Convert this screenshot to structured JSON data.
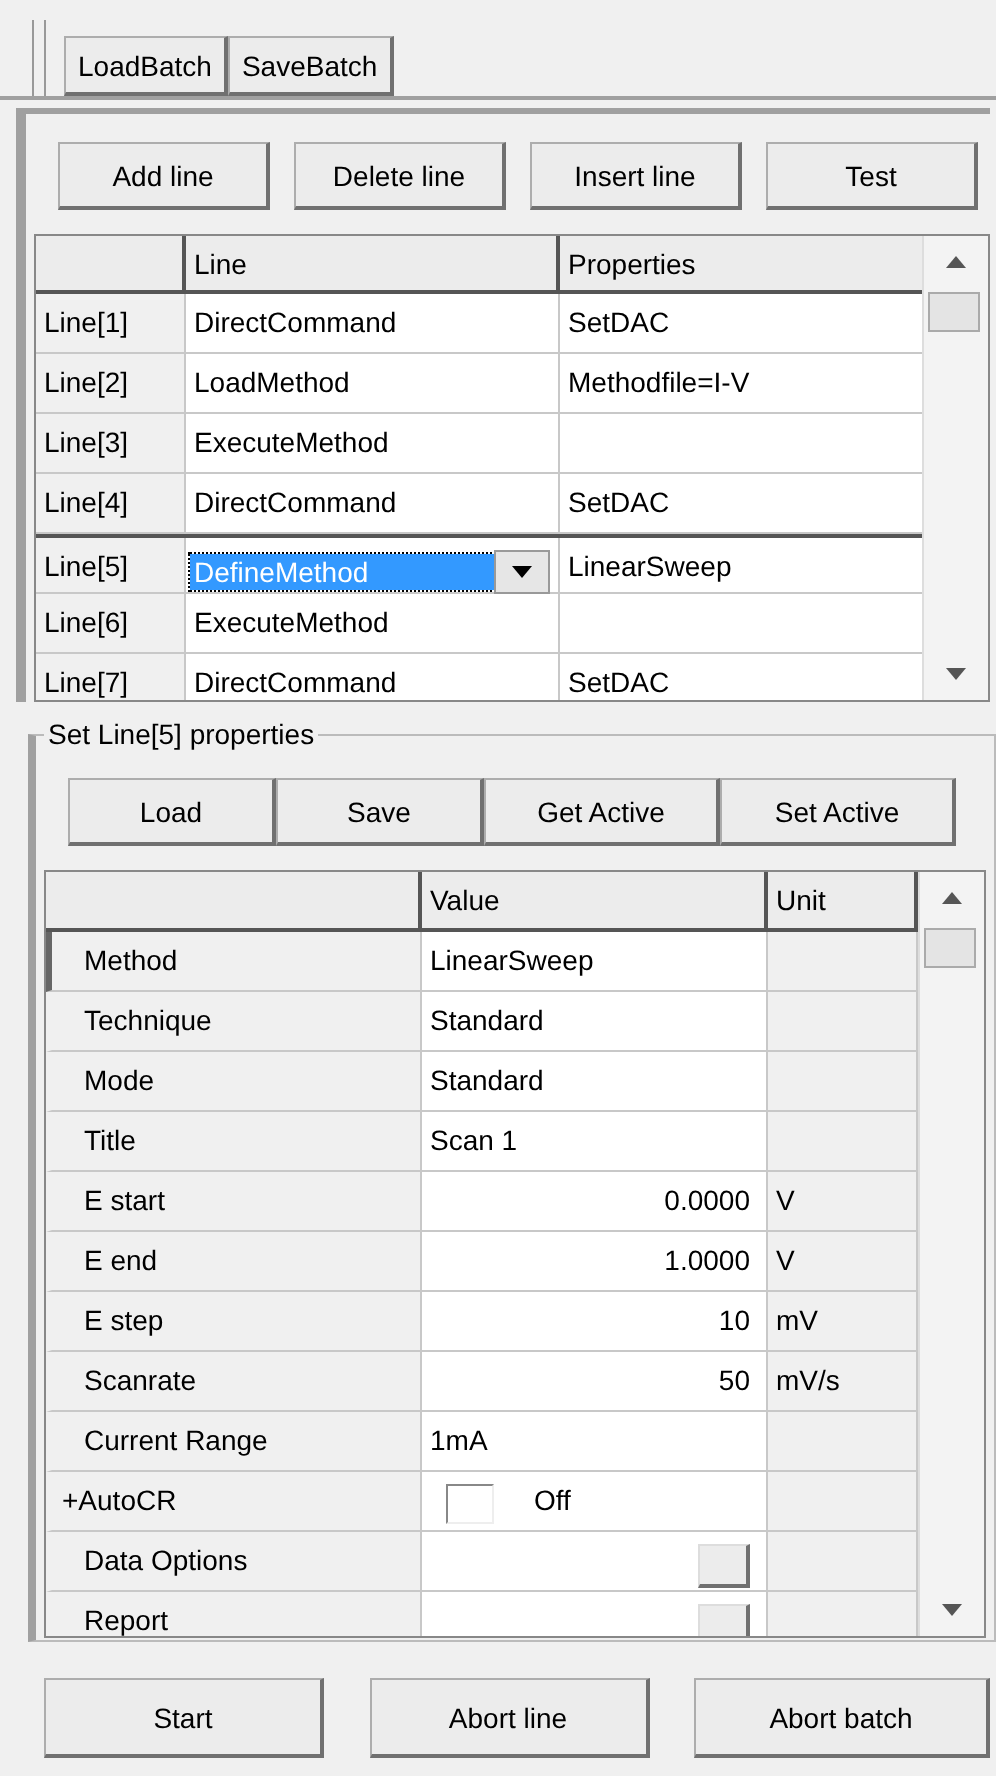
{
  "toolbar": [
    "LoadBatch",
    "SaveBatch"
  ],
  "line_buttons": [
    "Add line",
    "Delete line",
    "Insert line",
    "Test"
  ],
  "batch_grid": {
    "columns": [
      "Line",
      "Properties"
    ],
    "rows": [
      {
        "header": "Line[1]",
        "line": "DirectCommand",
        "properties": "SetDAC",
        "selected": false
      },
      {
        "header": "Line[2]",
        "line": "LoadMethod",
        "properties": "Methodfile=I-V",
        "selected": false
      },
      {
        "header": "Line[3]",
        "line": "ExecuteMethod",
        "selected": false
      },
      {
        "header": "Line[4]",
        "line": "DirectCommand",
        "properties": "SetDAC",
        "selected": false
      },
      {
        "header": "Line[5]",
        "line": "DefineMethod",
        "properties": "LinearSweep",
        "selected": true
      },
      {
        "header": "Line[6]",
        "line": "ExecuteMethod",
        "selected": false
      },
      {
        "header": "Line[7]",
        "line": "DirectCommand",
        "properties": "SetDAC",
        "selected": false
      }
    ]
  },
  "properties_group": {
    "title": "Set Line[5] properties",
    "buttons": [
      "Load",
      "Save",
      "Get Active",
      "Set Active"
    ],
    "grid": {
      "columns": [
        "Value",
        "Unit"
      ],
      "rows": [
        {
          "kind": "text",
          "name": "Method",
          "value": "LinearSweep",
          "selected": true
        },
        {
          "kind": "text",
          "name": "Technique",
          "value": "Standard",
          "selected": false
        },
        {
          "kind": "text",
          "name": "Mode",
          "value": "Standard",
          "selected": false
        },
        {
          "kind": "text",
          "name": "Title",
          "value": "Scan 1",
          "selected": false
        },
        {
          "kind": "number",
          "name": "E start",
          "value": "0.0000",
          "unit": "V",
          "selected": false
        },
        {
          "kind": "number",
          "name": "E end",
          "value": "1.0000",
          "unit": "V",
          "selected": false
        },
        {
          "kind": "number",
          "name": "E step",
          "value": "10",
          "unit": "mV",
          "selected": false
        },
        {
          "kind": "number",
          "name": "Scanrate",
          "value": "50",
          "unit": "mV/s",
          "selected": false
        },
        {
          "kind": "text",
          "name": "Current Range",
          "value": "1mA",
          "selected": false
        },
        {
          "kind": "checkbox",
          "name": "+AutoCR",
          "value": "Off",
          "checked": false,
          "expandable": true,
          "selected": false
        },
        {
          "kind": "button",
          "name": "Data Options",
          "selected": false
        },
        {
          "kind": "button",
          "name": "Report",
          "selected": false
        }
      ]
    }
  },
  "bottom_buttons": [
    "Start",
    "Abort line",
    "Abort batch"
  ]
}
